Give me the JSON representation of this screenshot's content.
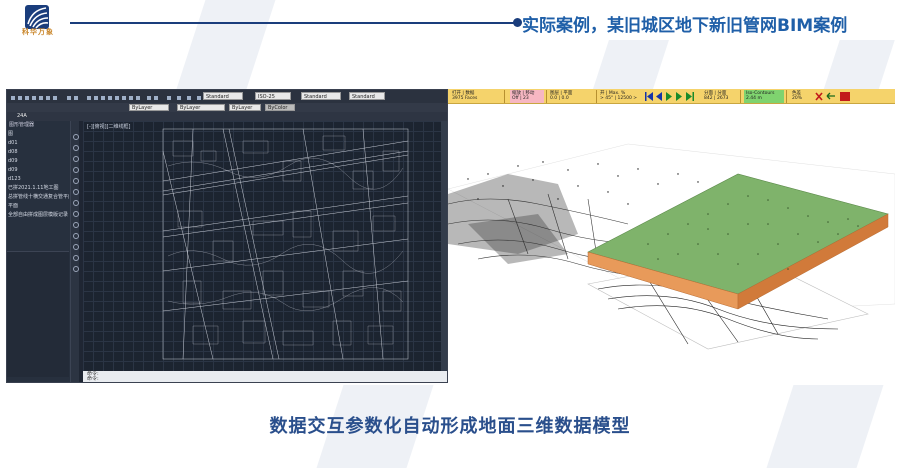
{
  "header": {
    "title": "实际案例，某旧城区地下新旧管网BIM案例",
    "logo_text": "科华万象"
  },
  "cad_panel": {
    "tab_label": "24A",
    "selects": [
      "Standard",
      "ISO-25",
      "Standard",
      "Standard"
    ],
    "layer_selects": [
      "ByLayer",
      "ByLayer",
      "ByLayer",
      "ByColor"
    ],
    "view_label": "[-][俯视][二维线框]",
    "sidebar_header": "图形管理器",
    "sidebar_items": [
      "图",
      "d01",
      "d08",
      "d09",
      "d09",
      "d123",
      "已拼2021.1.11地工图",
      "总拼管线十横交通复合管平面图",
      "平面",
      "全部自由拼成图层模版记录"
    ],
    "command_lines": [
      "命令:",
      "命令:"
    ]
  },
  "panel_3d": {
    "toolbar": [
      {
        "label": "打开 | 数据",
        "value": "3975 Faces"
      },
      {
        "label": "缩放 | 移动",
        "value": "Off | 23"
      },
      {
        "label": "图层 | 平面",
        "value": "0.0 | 0.0"
      },
      {
        "label": "开 | Max. %",
        "value": "> 45° | 12500 >"
      },
      {
        "label": "分面 | 分面",
        "value": "842 | 2673"
      },
      {
        "label": "Iso-Contours",
        "value": "2.44 m"
      },
      {
        "label": "色差",
        "value": "20%"
      }
    ]
  },
  "caption": "数据交互参数化自动形成地面三维数据模型",
  "colors": {
    "accent": "#1f5fa8",
    "header_line": "#1a3d7c",
    "caption": "#2a4f8c",
    "cad_bg": "#1c2430",
    "terrain_green": "#7fb36b",
    "terrain_orange": "#e89a5a",
    "toolbar_yellow": "#f5d36b"
  }
}
